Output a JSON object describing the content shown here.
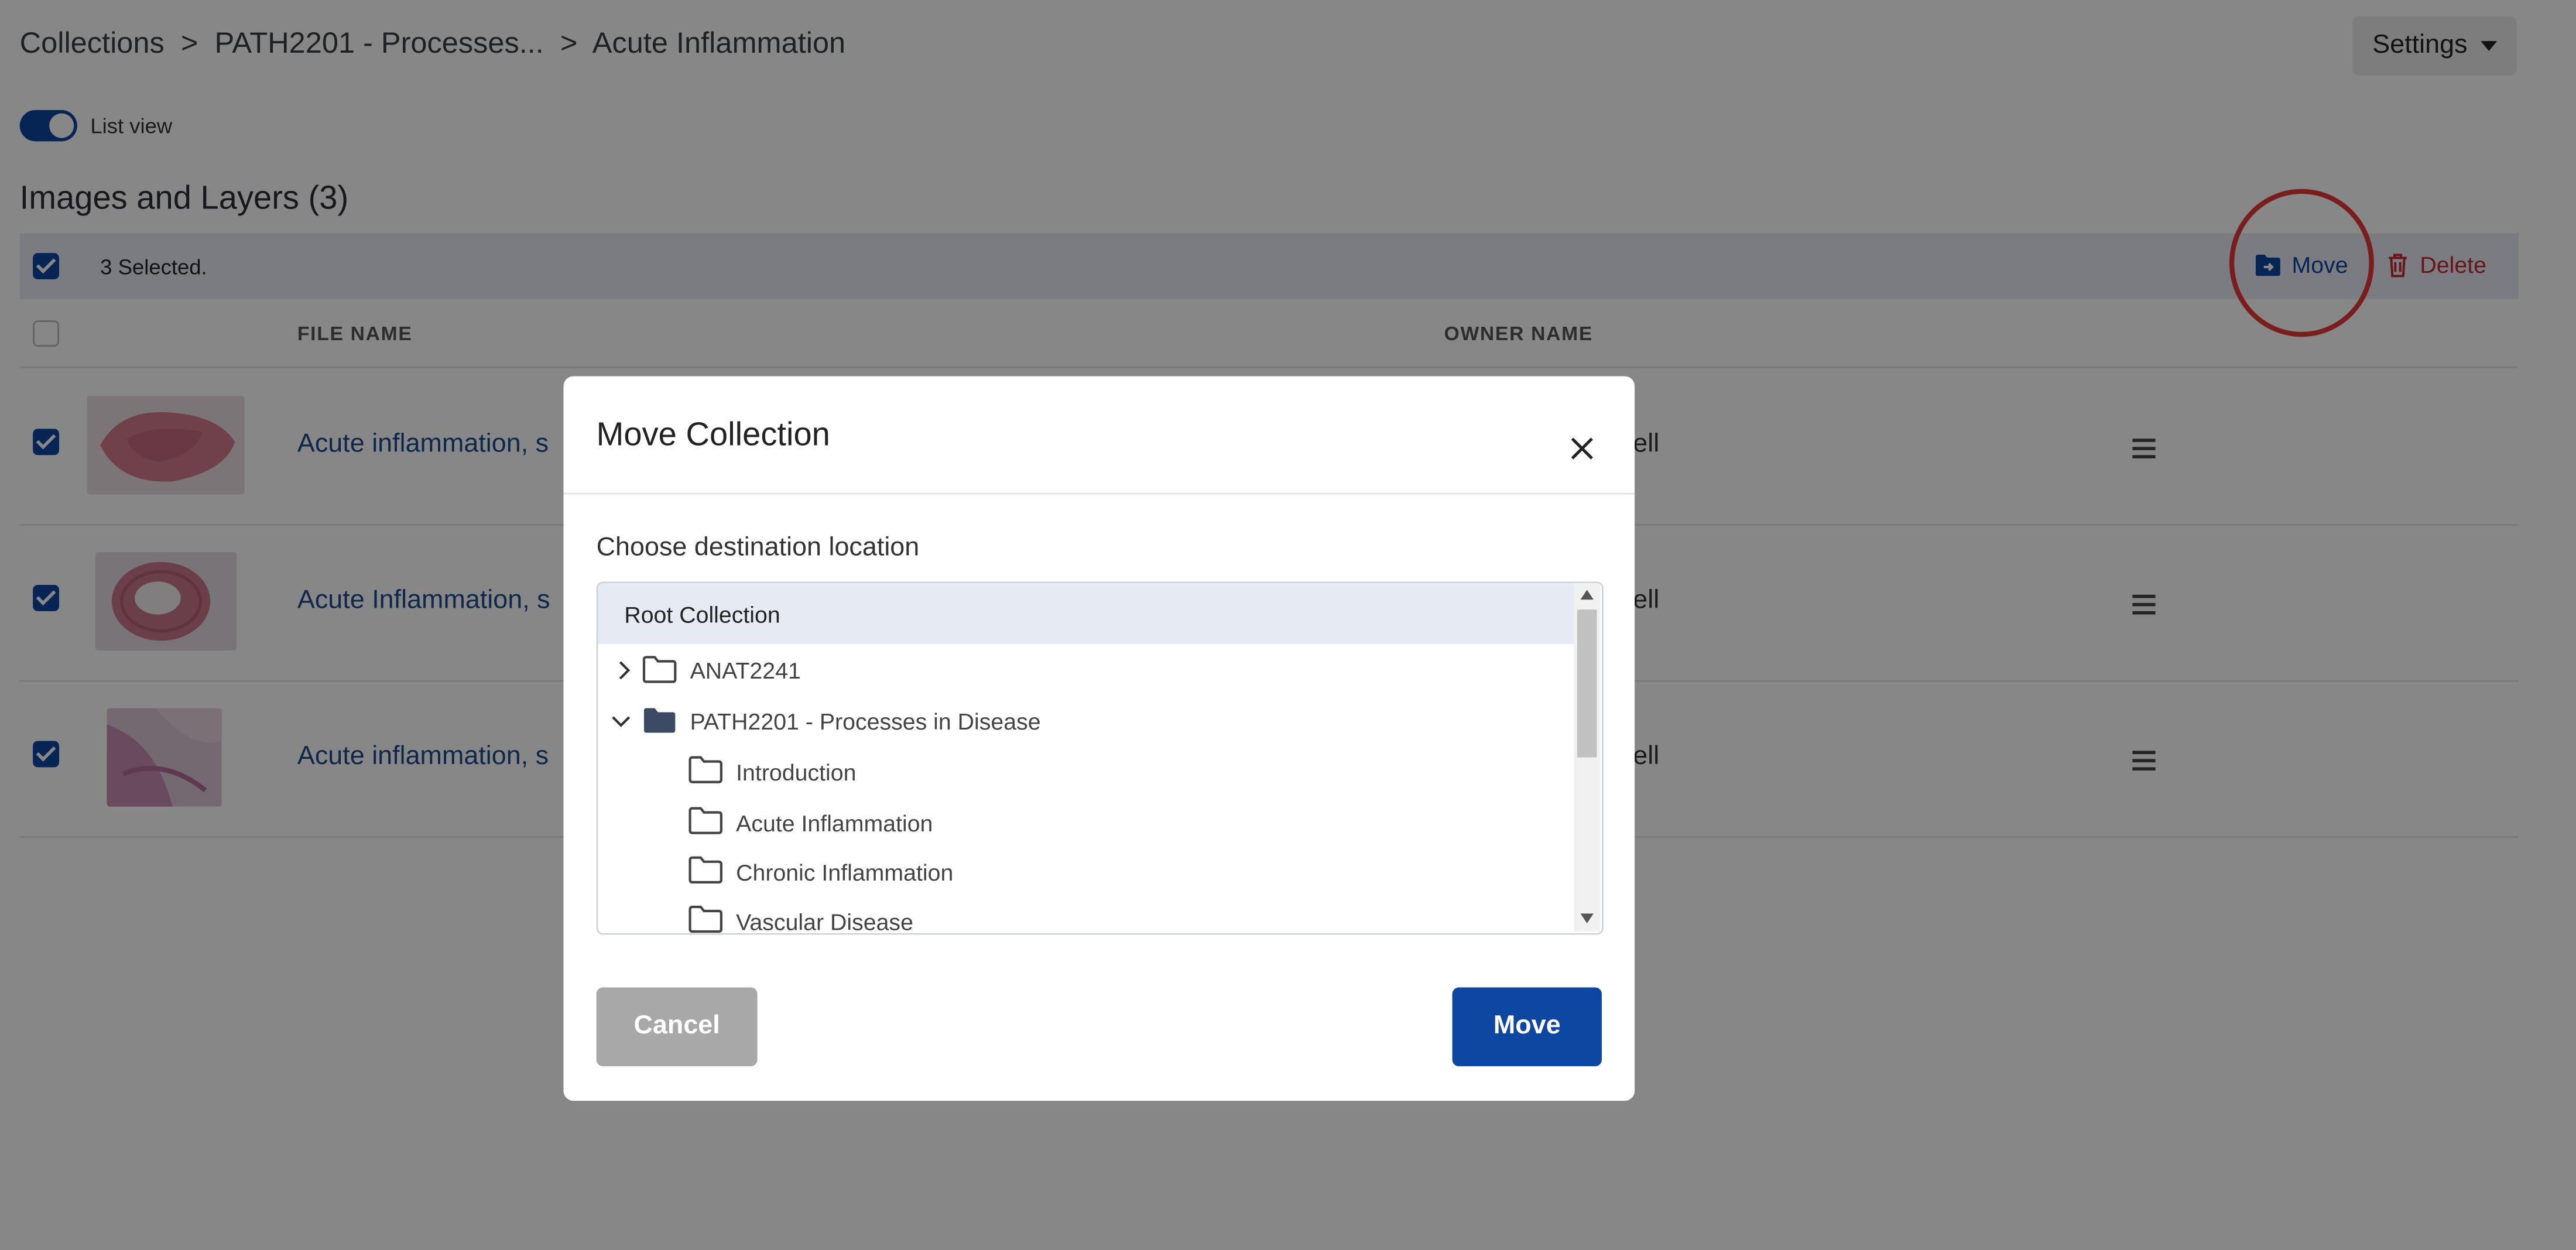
{
  "breadcrumb": {
    "root": "Collections",
    "sep1": ">",
    "parent": "PATH2201 - Processes...",
    "sep2": ">",
    "current": "Acute Inflammation"
  },
  "settings_label": "Settings",
  "list_view": {
    "label": "List view",
    "enabled": true
  },
  "section_title": "Images and Layers (3)",
  "selection": {
    "text": "3 Selected.",
    "all_checked": true,
    "move_label": "Move",
    "delete_label": "Delete"
  },
  "table": {
    "headers": {
      "file_name": "FILE NAME",
      "owner_name": "OWNER NAME"
    },
    "rows": [
      {
        "file_name": "Acute inflammation, s",
        "owner_visible": "ell",
        "checked": true
      },
      {
        "file_name": "Acute Inflammation, s",
        "owner_visible": "ell",
        "checked": true
      },
      {
        "file_name": "Acute inflammation, s",
        "owner_visible": "ell",
        "checked": true
      }
    ]
  },
  "modal": {
    "title": "Move Collection",
    "close_icon": "close-icon",
    "destination_label": "Choose destination location",
    "tree": {
      "root": "Root Collection",
      "nodes": [
        {
          "label": "ANAT2241",
          "expanded": false
        },
        {
          "label": "PATH2201 - Processes in Disease",
          "expanded": true,
          "children": [
            "Introduction",
            "Acute Inflammation",
            "Chronic Inflammation",
            "Vascular Disease"
          ]
        }
      ]
    },
    "cancel_label": "Cancel",
    "move_label": "Move"
  },
  "colors": {
    "primary": "#0d47a1",
    "danger": "#c62828",
    "overlay": "rgba(0,0,0,0.47)",
    "highlight_circle": "#e53935"
  }
}
